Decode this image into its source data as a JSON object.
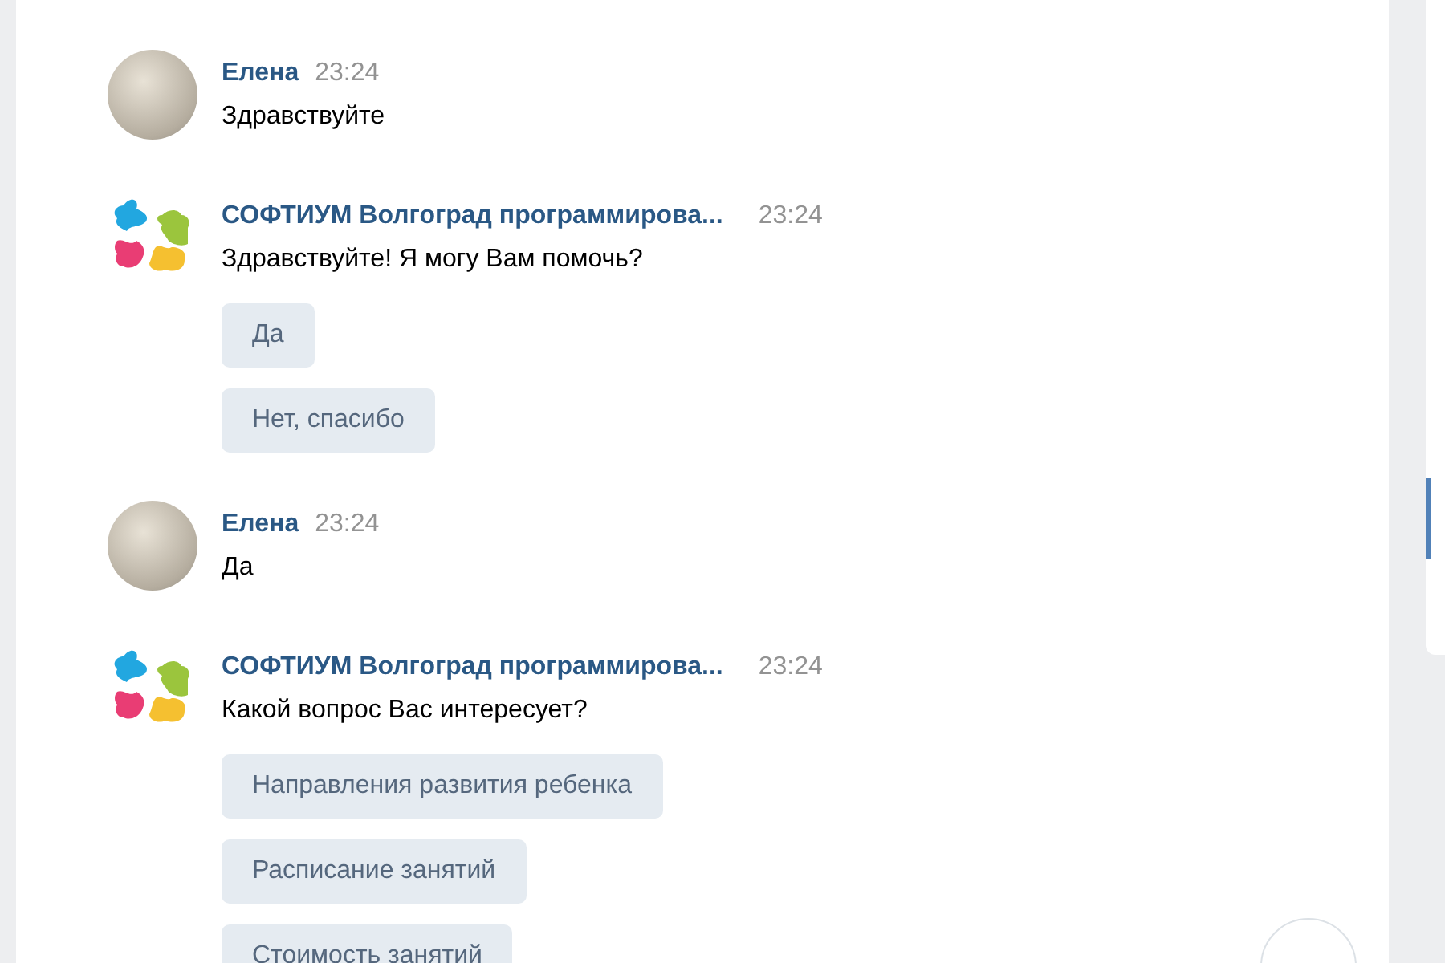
{
  "messages": [
    {
      "kind": "user",
      "author": "Елена",
      "time": "23:24",
      "text": "Здравствуйте"
    },
    {
      "kind": "bot",
      "author": "СОФТИУМ Волгоград программирова...",
      "time": "23:24",
      "text": "Здравствуйте! Я могу Вам помочь?",
      "buttons": [
        "Да",
        "Нет, спасибо"
      ]
    },
    {
      "kind": "user",
      "author": "Елена",
      "time": "23:24",
      "text": "Да"
    },
    {
      "kind": "bot",
      "author": "СОФТИУМ Волгоград программирова...",
      "time": "23:24",
      "text": "Какой вопрос Вас интересует?",
      "buttons": [
        "Направления развития ребенка",
        "Расписание занятий",
        "Стоимость занятий"
      ]
    }
  ]
}
